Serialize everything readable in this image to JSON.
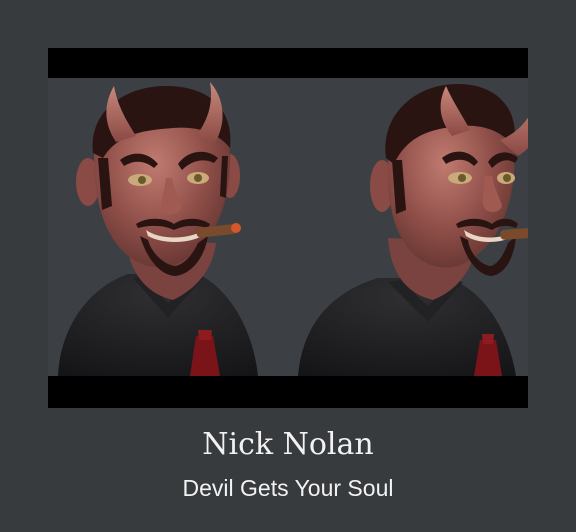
{
  "artwork": {
    "image_alt": "3D sculpted bust of a grinning devil with horns, goatee and a lit cigar, shown from two angles"
  },
  "caption": {
    "artist": "Nick Nolan",
    "title": "Devil Gets Your Soul"
  }
}
